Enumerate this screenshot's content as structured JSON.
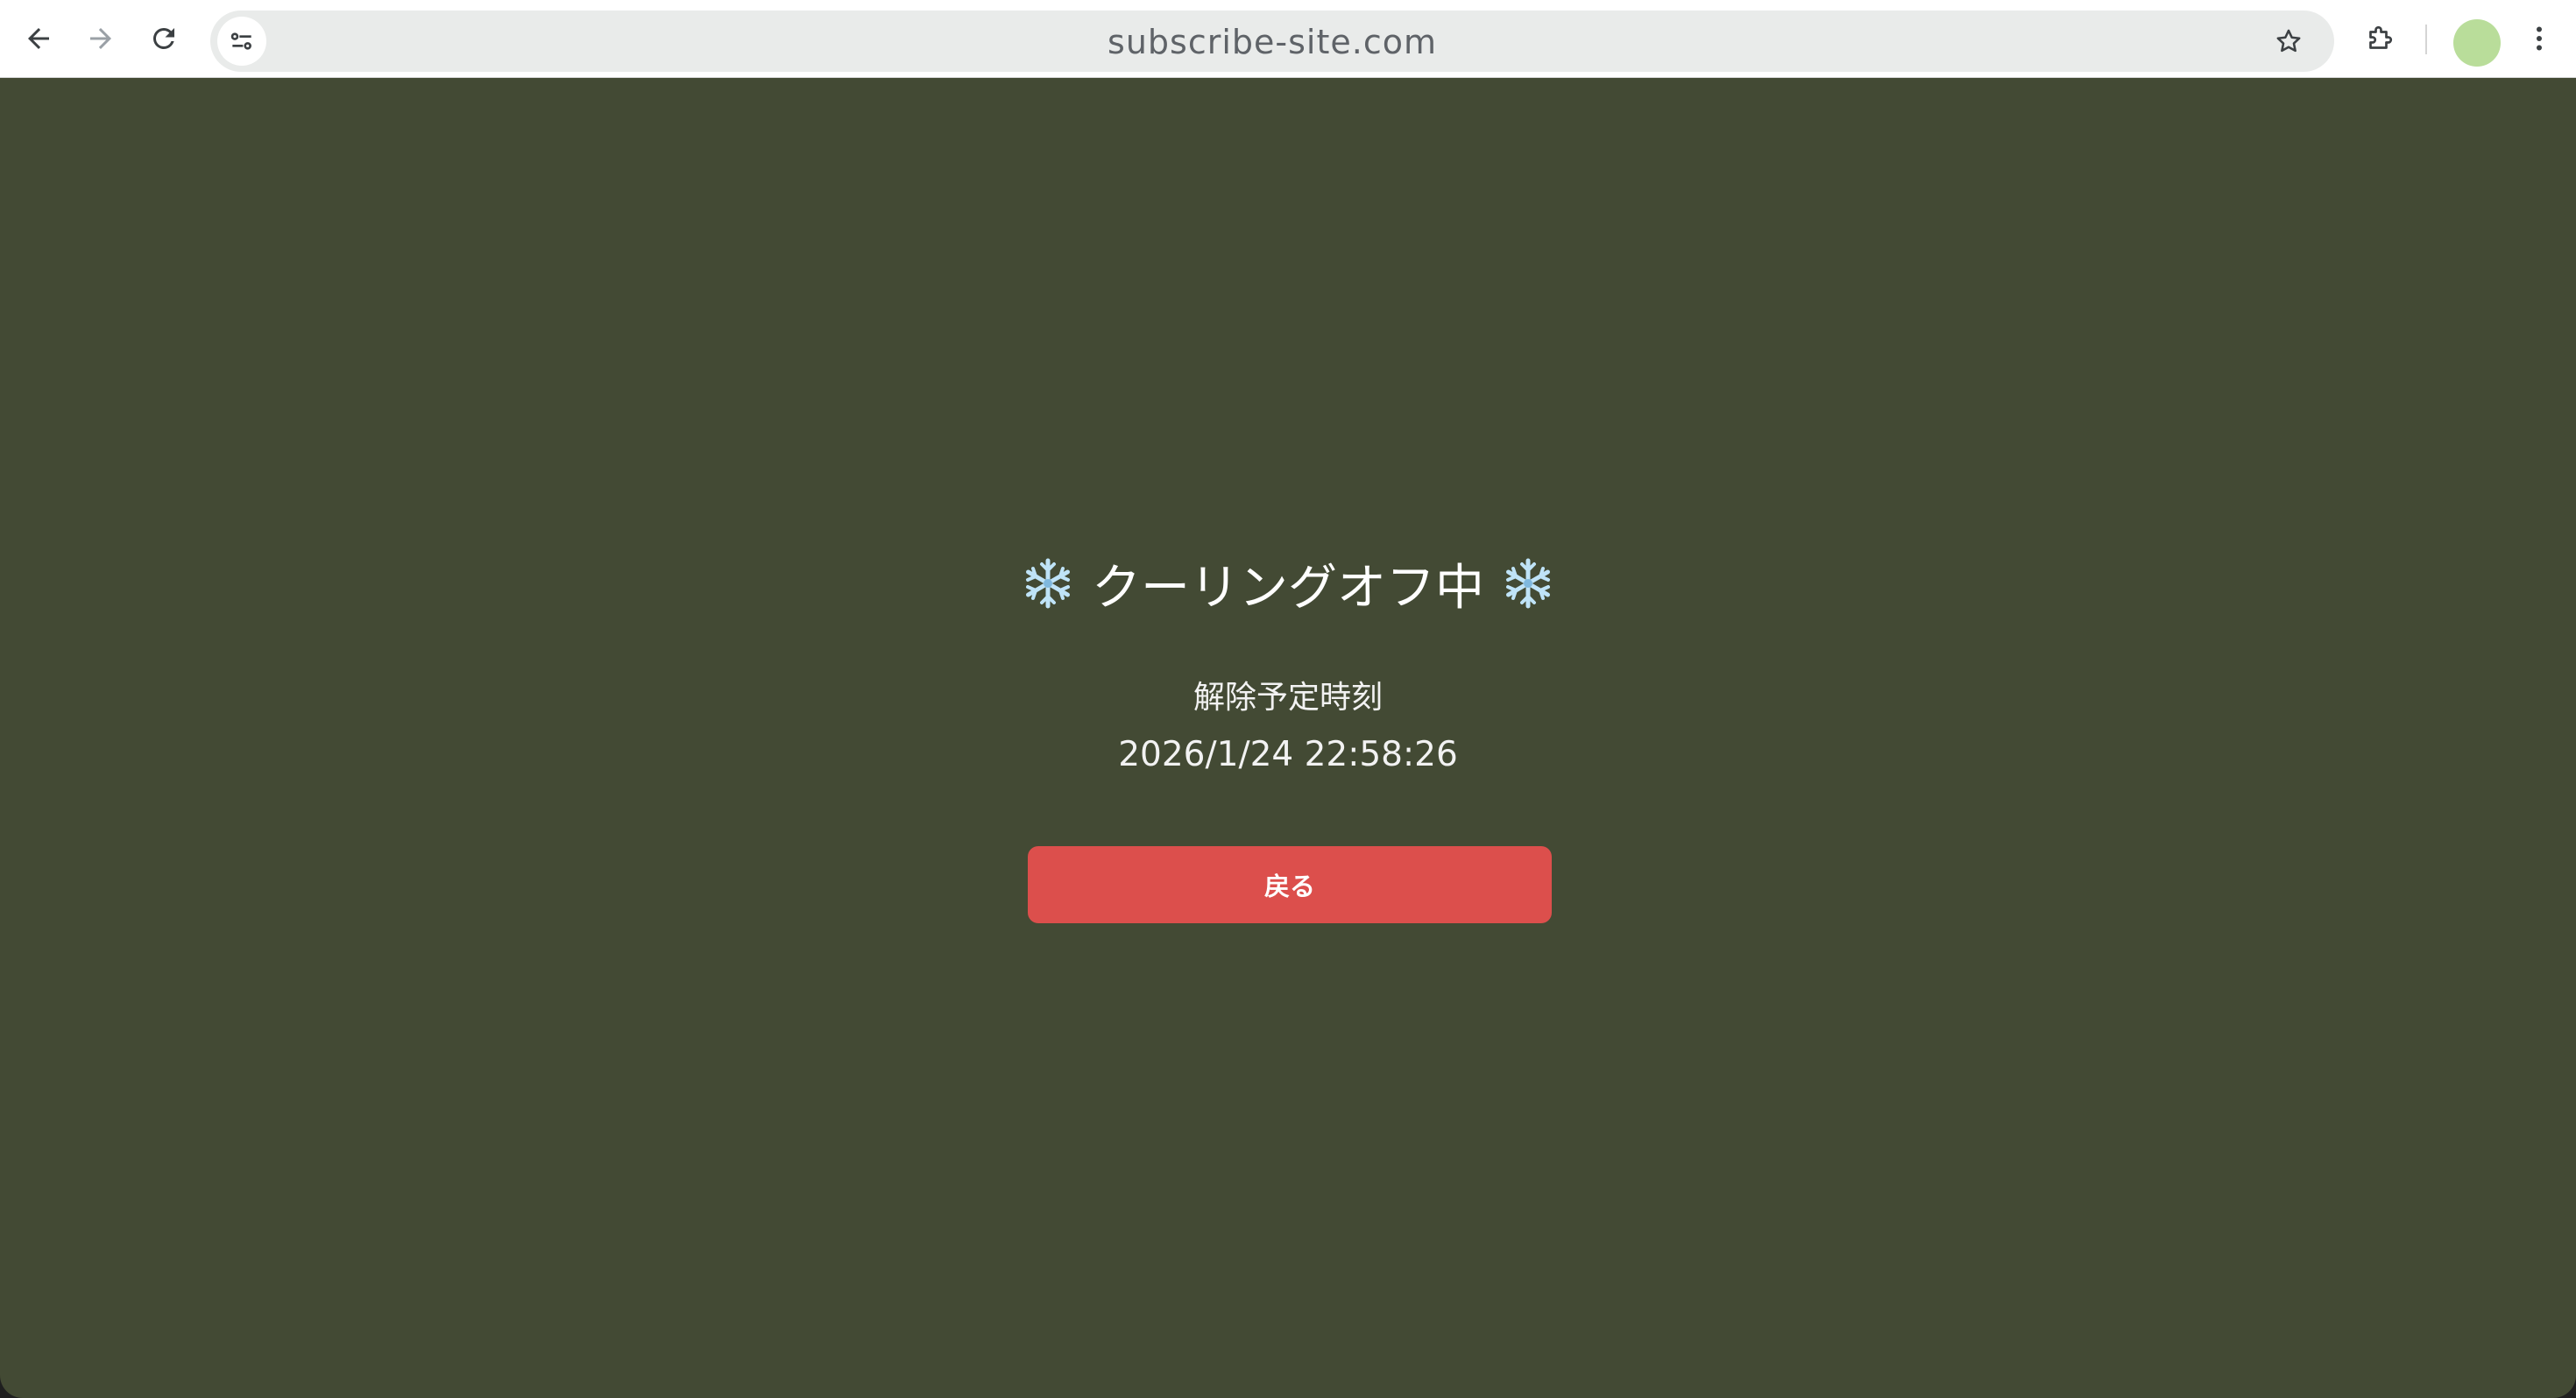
{
  "browser": {
    "url": "subscribe-site.com",
    "icons": {
      "back": "arrow-left-icon",
      "forward": "arrow-right-icon",
      "reload": "reload-icon",
      "site_info": "tune-icon",
      "bookmark": "star-icon",
      "extensions": "puzzle-icon",
      "profile": "avatar",
      "menu": "kebab-menu-icon"
    },
    "avatar_color": "#b9dd9a"
  },
  "page": {
    "background_color": "#434a34",
    "heading": "クーリングオフ中",
    "heading_icon": "snowflake-icon",
    "release_label": "解除予定時刻",
    "release_time": "2026/1/24 22:58:26",
    "back_button_label": "戻る",
    "back_button_color": "#dc4f4c"
  }
}
